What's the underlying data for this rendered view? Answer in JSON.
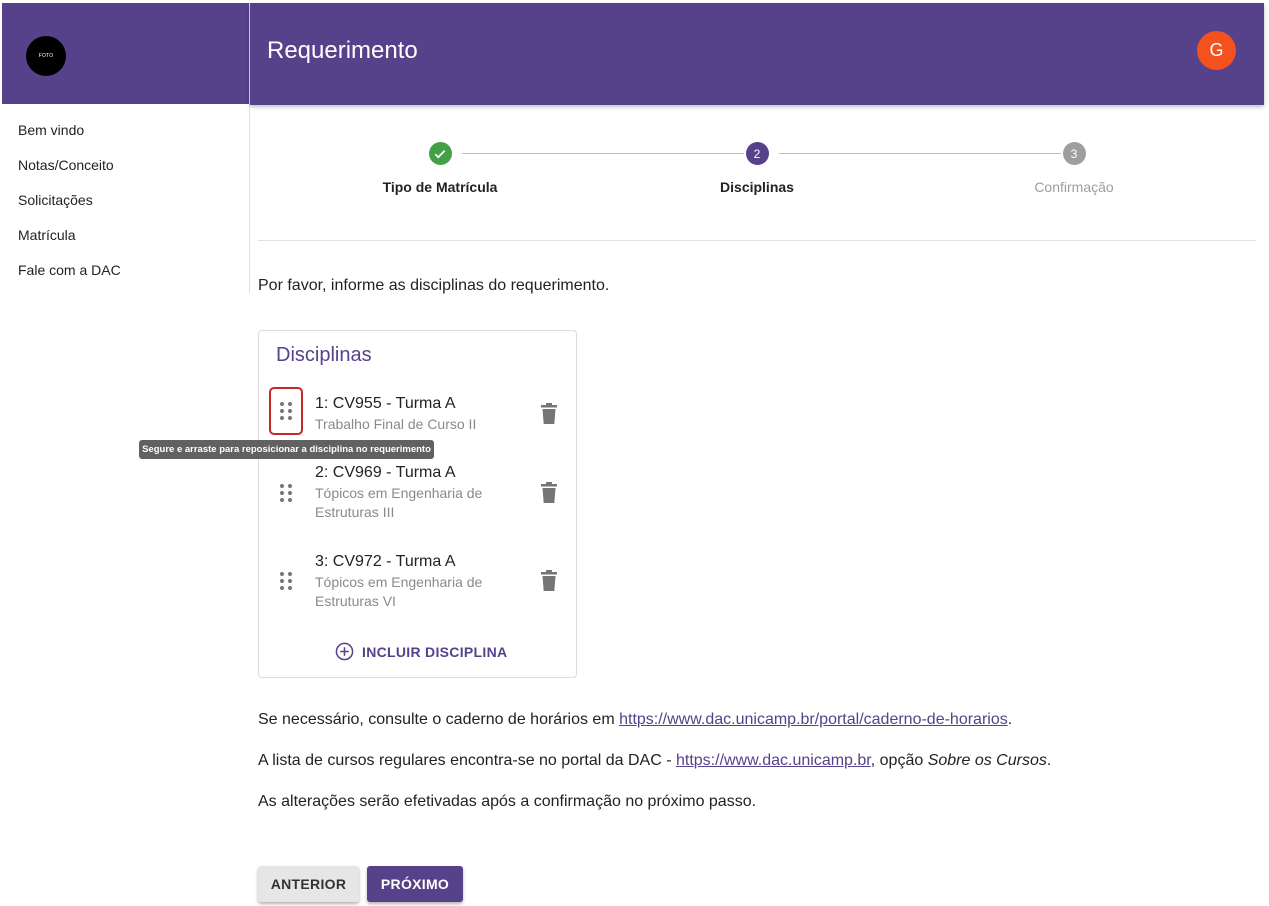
{
  "sidebar": {
    "photo_label": "FOTO",
    "items": [
      {
        "label": "Bem vindo"
      },
      {
        "label": "Notas/Conceito"
      },
      {
        "label": "Solicitações"
      },
      {
        "label": "Matrícula"
      },
      {
        "label": "Fale com a DAC"
      }
    ]
  },
  "header": {
    "title": "Requerimento",
    "user_initial": "G"
  },
  "stepper": {
    "steps": [
      {
        "number": "",
        "label": "Tipo de Matrícula",
        "state": "completed"
      },
      {
        "number": "2",
        "label": "Disciplinas",
        "state": "active"
      },
      {
        "number": "3",
        "label": "Confirmação",
        "state": "pending"
      }
    ]
  },
  "intro": "Por favor, informe as disciplinas do requerimento.",
  "card": {
    "title": "Disciplinas",
    "items": [
      {
        "title": "1: CV955 - Turma A",
        "subtitle": "Trabalho Final de Curso II"
      },
      {
        "title": "2: CV969 - Turma A",
        "subtitle": "Tópicos em Engenharia de Estruturas III"
      },
      {
        "title": "3: CV972 - Turma A",
        "subtitle": "Tópicos em Engenharia de Estruturas VI"
      }
    ],
    "add_label": "INCLUIR DISCIPLINA"
  },
  "tooltip": "Segure e arraste para reposicionar a disciplina no requerimento",
  "info": {
    "p1_prefix": "Se necessário, consulte o caderno de horários em ",
    "p1_link": "https://www.dac.unicamp.br/portal/caderno-de-horarios",
    "p1_suffix": ".",
    "p2_prefix": "A lista de cursos regulares encontra-se no portal da DAC - ",
    "p2_link": "https://www.dac.unicamp.br",
    "p2_middle": ", opção ",
    "p2_italic": "Sobre os Cursos",
    "p2_suffix": ".",
    "p3": "As alterações serão efetivadas após a confirmação no próximo passo."
  },
  "buttons": {
    "previous": "ANTERIOR",
    "next": "PRÓXIMO"
  },
  "colors": {
    "primary": "#55428b",
    "success": "#43a047",
    "pending": "#9e9e9e",
    "avatar": "#f4511e",
    "highlight": "#c62828"
  }
}
